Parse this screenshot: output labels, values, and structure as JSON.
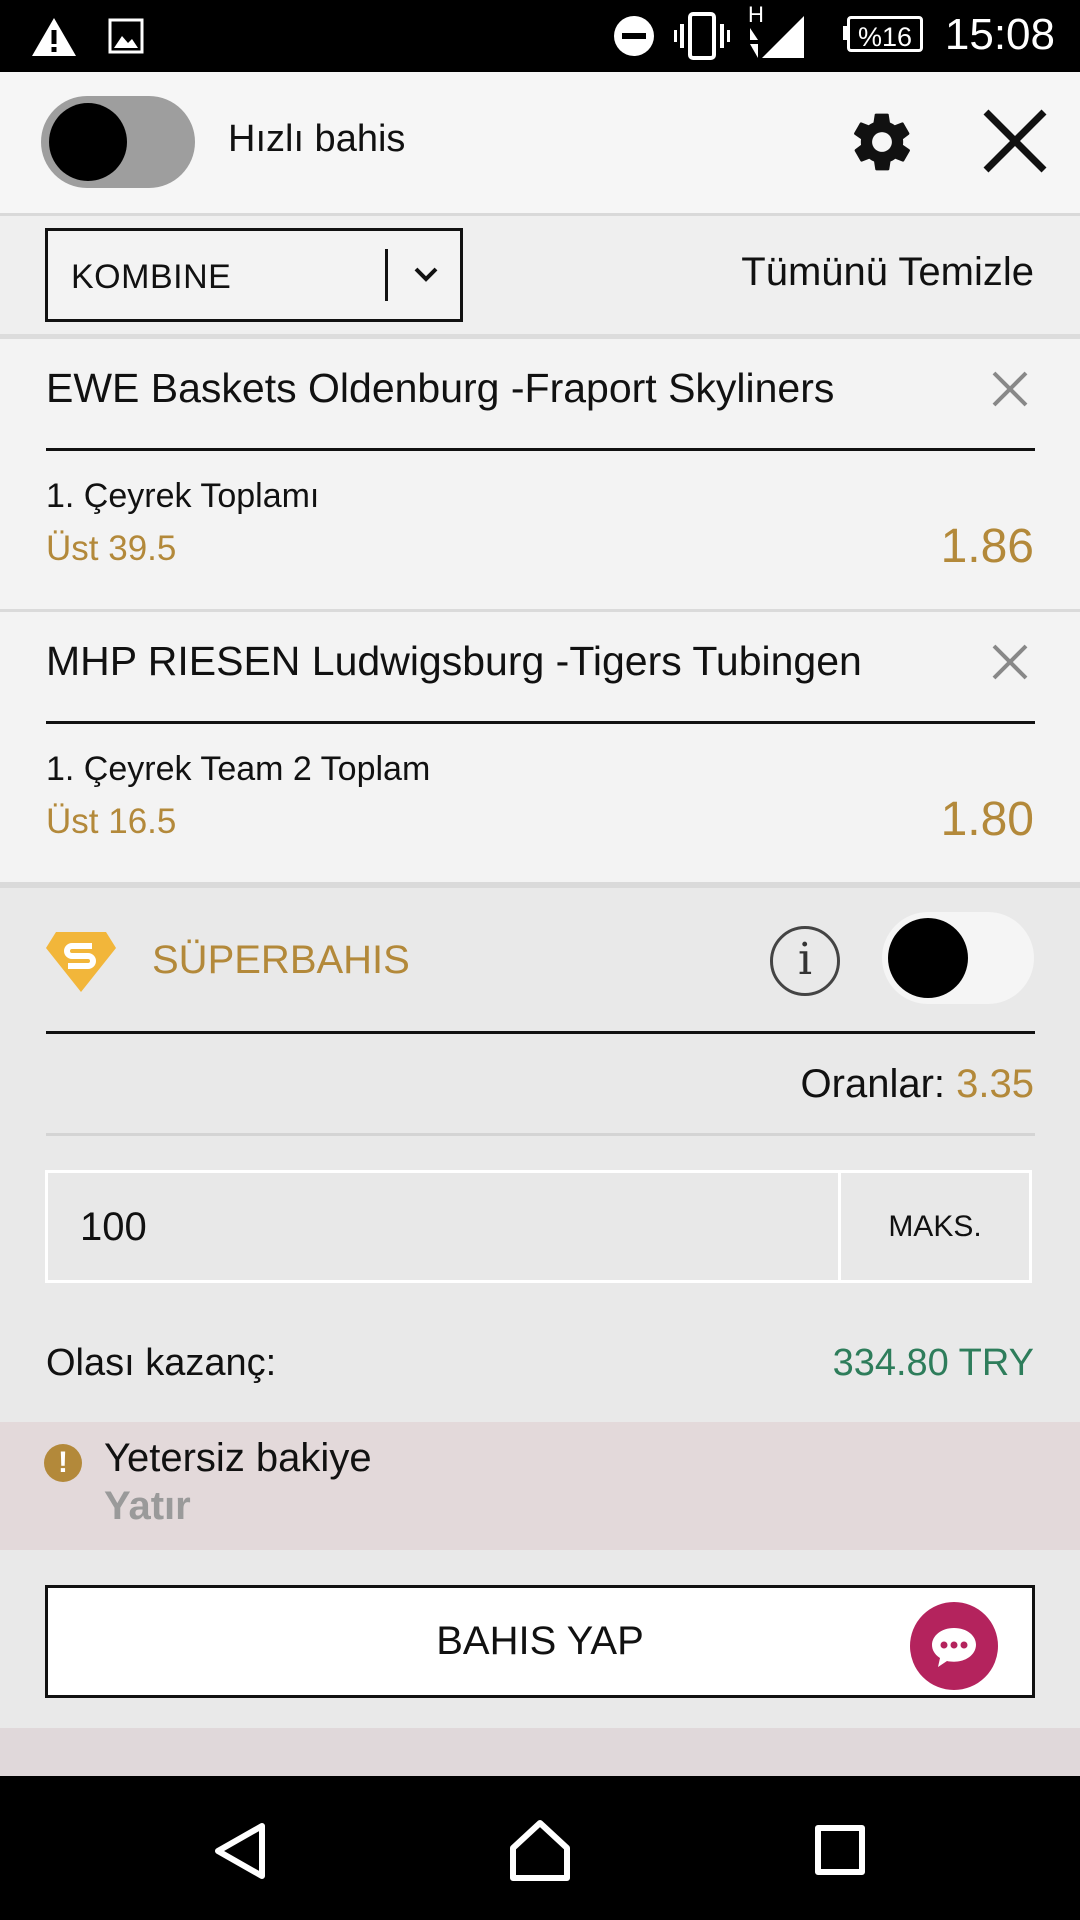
{
  "status_bar": {
    "time": "15:08",
    "battery": "%16",
    "network": "H"
  },
  "header": {
    "quick_bet_label": "Hızlı bahis",
    "quick_bet_enabled": false
  },
  "bet_type": {
    "selected": "KOMBINE",
    "clear_all": "Tümünü Temizle"
  },
  "bets": [
    {
      "match": "EWE Baskets Oldenburg -Fraport Skyliners",
      "market": "1. Çeyrek Toplamı",
      "selection": "Üst 39.5",
      "odds": "1.86"
    },
    {
      "match": "MHP RIESEN Ludwigsburg -Tigers Tubingen",
      "market": "1. Çeyrek Team 2 Toplam",
      "selection": "Üst 16.5",
      "odds": "1.80"
    }
  ],
  "superbet": {
    "label": "SÜPERBAHIS",
    "info_glyph": "i",
    "enabled": false
  },
  "summary": {
    "odds_label": "Oranlar:",
    "odds_value": "3.35",
    "stake": "100",
    "max_label": "MAKS.",
    "potential_win_label": "Olası kazanç:",
    "potential_win_value": "334.80 TRY"
  },
  "warning": {
    "message": "Yetersiz bakiye",
    "action": "Yatır",
    "icon_glyph": "!"
  },
  "place_bet_label": "BAHIS YAP",
  "colors": {
    "accent_gold": "#b3893a",
    "win_green": "#2e7d5b",
    "chat_magenta": "#b4235d"
  }
}
